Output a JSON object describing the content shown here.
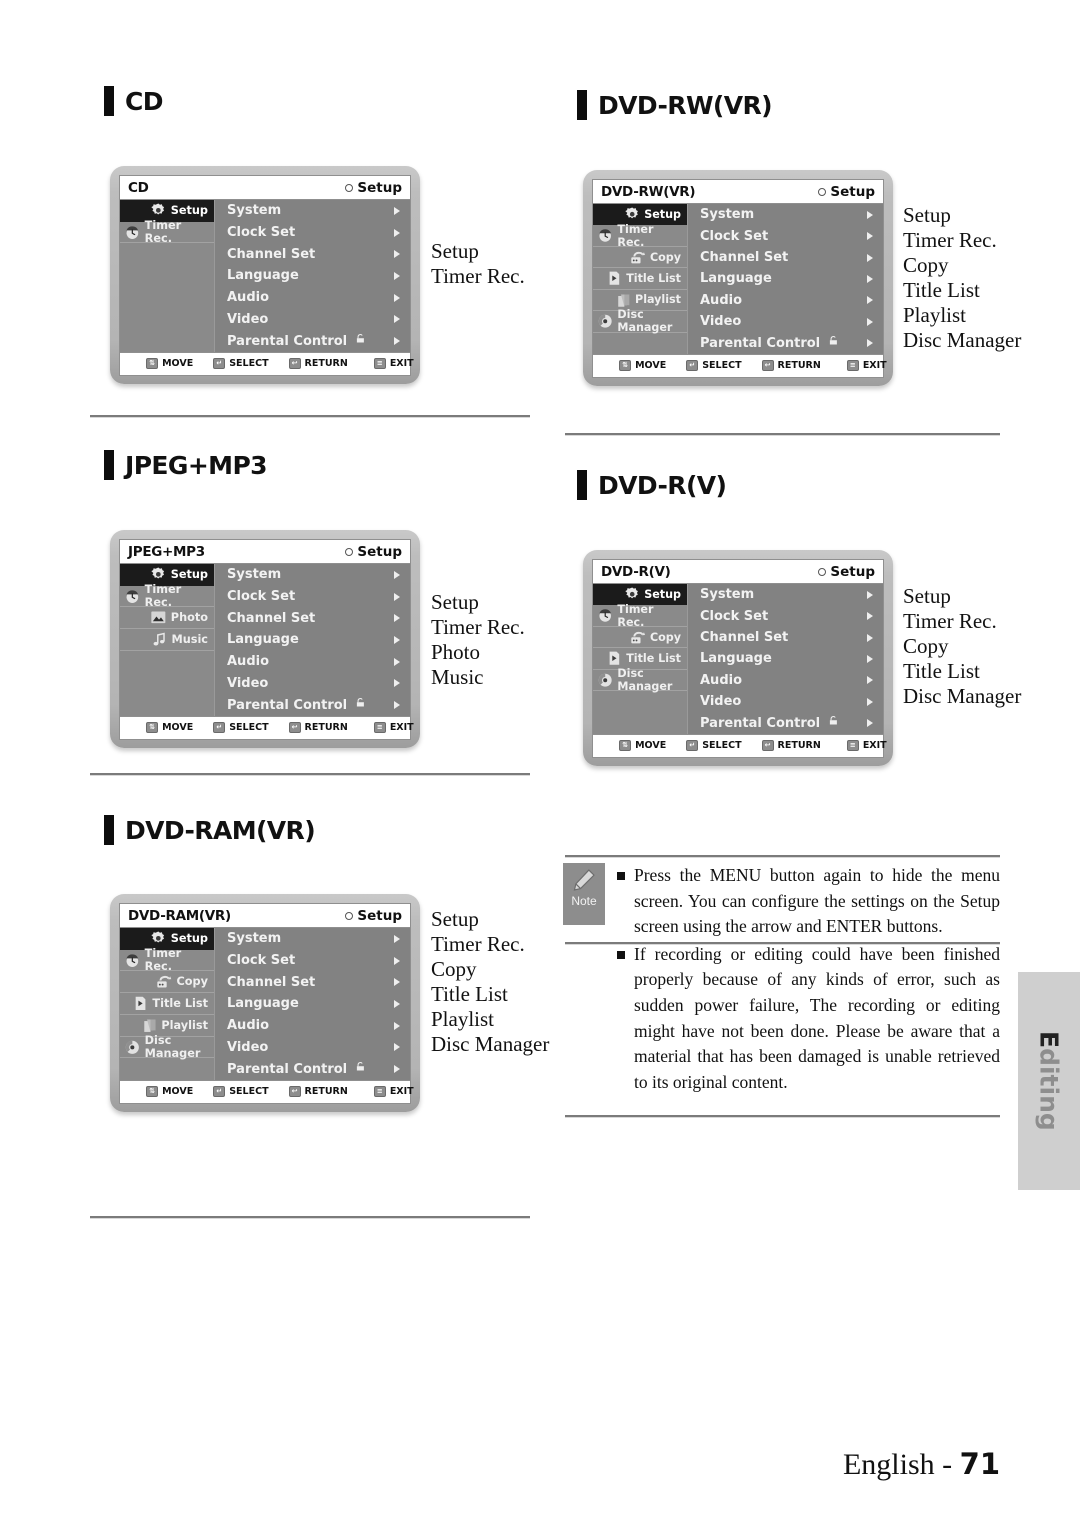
{
  "page": {
    "footer_text": "English - ",
    "footer_page": "71",
    "side_tab": "Editing"
  },
  "common": {
    "setup_label": "Setup",
    "disc_icon": "disc-icon",
    "options": [
      {
        "label": "System",
        "lock": false
      },
      {
        "label": "Clock Set",
        "lock": false
      },
      {
        "label": "Channel Set",
        "lock": false
      },
      {
        "label": "Language",
        "lock": false
      },
      {
        "label": "Audio",
        "lock": false
      },
      {
        "label": "Video",
        "lock": false
      },
      {
        "label": "Parental Control",
        "lock": true
      }
    ],
    "footbar": [
      {
        "key": "updown-key",
        "label": "MOVE"
      },
      {
        "key": "enter-key",
        "label": "SELECT"
      },
      {
        "key": "return-key",
        "label": "RETURN"
      },
      {
        "key": "exit-key",
        "label": "EXIT"
      }
    ]
  },
  "sections": [
    {
      "id": "cd",
      "heading": "CD",
      "osd_title": "CD",
      "nav": [
        {
          "label": "Setup",
          "icon": "gear-icon",
          "selected": true
        },
        {
          "label": "Timer Rec.",
          "icon": "timer-rec-icon",
          "selected": false
        }
      ],
      "captions": [
        "Setup",
        "Timer Rec."
      ]
    },
    {
      "id": "dvd-rw-vr",
      "heading": "DVD-RW(VR)",
      "osd_title": "DVD-RW(VR)",
      "nav": [
        {
          "label": "Setup",
          "icon": "gear-icon",
          "selected": true
        },
        {
          "label": "Timer Rec.",
          "icon": "timer-rec-icon",
          "selected": false
        },
        {
          "label": "Copy",
          "icon": "copy-icon",
          "selected": false
        },
        {
          "label": "Title List",
          "icon": "title-list-icon",
          "selected": false
        },
        {
          "label": "Playlist",
          "icon": "playlist-icon",
          "selected": false
        },
        {
          "label": "Disc Manager",
          "icon": "disc-manager-icon",
          "selected": false
        }
      ],
      "captions": [
        "Setup",
        "Timer Rec.",
        "Copy",
        "Title List",
        "Playlist",
        "Disc Manager"
      ]
    },
    {
      "id": "jpeg-mp3",
      "heading": "JPEG+MP3",
      "osd_title": "JPEG+MP3",
      "nav": [
        {
          "label": "Setup",
          "icon": "gear-icon",
          "selected": true
        },
        {
          "label": "Timer Rec.",
          "icon": "timer-rec-icon",
          "selected": false
        },
        {
          "label": "Photo",
          "icon": "photo-icon",
          "selected": false
        },
        {
          "label": "Music",
          "icon": "music-icon",
          "selected": false
        }
      ],
      "captions": [
        "Setup",
        "Timer Rec.",
        "Photo",
        "Music"
      ]
    },
    {
      "id": "dvd-r-v",
      "heading": "DVD-R(V)",
      "osd_title": "DVD-R(V)",
      "nav": [
        {
          "label": "Setup",
          "icon": "gear-icon",
          "selected": true
        },
        {
          "label": "Timer Rec.",
          "icon": "timer-rec-icon",
          "selected": false
        },
        {
          "label": "Copy",
          "icon": "copy-icon",
          "selected": false
        },
        {
          "label": "Title List",
          "icon": "title-list-icon",
          "selected": false
        },
        {
          "label": "Disc Manager",
          "icon": "disc-manager-icon",
          "selected": false
        }
      ],
      "captions": [
        "Setup",
        "Timer Rec.",
        "Copy",
        "Title List",
        "Disc Manager"
      ]
    },
    {
      "id": "dvd-ram-vr",
      "heading": "DVD-RAM(VR)",
      "osd_title": "DVD-RAM(VR)",
      "nav": [
        {
          "label": "Setup",
          "icon": "gear-icon",
          "selected": true
        },
        {
          "label": "Timer Rec.",
          "icon": "timer-rec-icon",
          "selected": false
        },
        {
          "label": "Copy",
          "icon": "copy-icon",
          "selected": false
        },
        {
          "label": "Title List",
          "icon": "title-list-icon",
          "selected": false
        },
        {
          "label": "Playlist",
          "icon": "playlist-icon",
          "selected": false
        },
        {
          "label": "Disc Manager",
          "icon": "disc-manager-icon",
          "selected": false
        }
      ],
      "captions": [
        "Setup",
        "Timer Rec.",
        "Copy",
        "Title List",
        "Playlist",
        "Disc Manager"
      ]
    }
  ],
  "note": {
    "label": "Note",
    "icon": "pencil-icon",
    "items": [
      "Press the MENU button again to hide the menu screen. You can configure the settings on the Setup screen using the arrow and ENTER buttons.",
      "If recording or editing could have been finished properly because of any kinds of error, such as sudden power failure, The recording or editing might have not been done. Please be aware that a material that has been damaged is unable retrieved to its original content."
    ]
  }
}
